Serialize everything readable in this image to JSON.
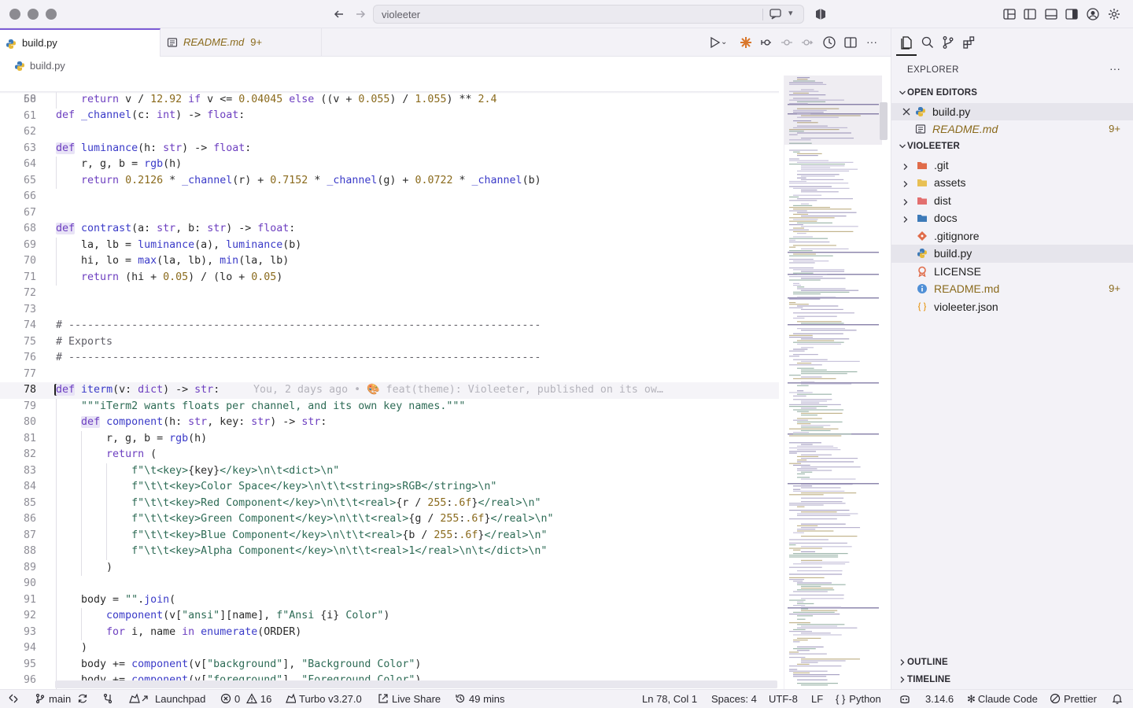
{
  "titlebar": {
    "search_text": "violeeter"
  },
  "tabs": [
    {
      "label": "build.py",
      "active": true
    },
    {
      "label": "README.md",
      "badge": "9+",
      "active": false
    }
  ],
  "breadcrumb": {
    "file": "build.py"
  },
  "editor": {
    "sticky_line": {
      "num": "58",
      "code": "def _channel(c: int) -> float:"
    },
    "current_line": "78",
    "blame": "You, 2 days ago • 🎨 feat(theme): Violeeter, published on its ow…",
    "lines": [
      "60",
      "61",
      "62",
      "63",
      "64",
      "65",
      "66",
      "67",
      "68",
      "69",
      "70",
      "71",
      "72",
      "73",
      "74",
      "75",
      "76",
      "77",
      "78",
      "79",
      "80",
      "81",
      "82",
      "83",
      "84",
      "85",
      "86",
      "87",
      "88",
      "89",
      "90",
      "91",
      "92",
      "93",
      "94",
      "95",
      "96"
    ]
  },
  "sidebar": {
    "title": "EXPLORER",
    "more": "···",
    "open_editors_label": "OPEN EDITORS",
    "open_editors": [
      {
        "label": "build.py"
      },
      {
        "label": "README.md",
        "badge": "9+"
      }
    ],
    "folder_label": "VIOLEETER",
    "tree": [
      {
        "label": ".git",
        "type": "folder"
      },
      {
        "label": "assets",
        "type": "folder"
      },
      {
        "label": "dist",
        "type": "folder"
      },
      {
        "label": "docs",
        "type": "folder"
      },
      {
        "label": ".gitignore",
        "type": "file"
      },
      {
        "label": "build.py",
        "type": "file"
      },
      {
        "label": "LICENSE",
        "type": "file"
      },
      {
        "label": "README.md",
        "type": "file",
        "badge": "9+"
      },
      {
        "label": "violeeter.json",
        "type": "file"
      }
    ],
    "outline_label": "OUTLINE",
    "timeline_label": "TIMELINE"
  },
  "statusbar": {
    "branch": "main",
    "launchpad": "Launchpad",
    "errors": "0",
    "warnings": "16",
    "turbo": "Turbo v3.27.0",
    "liveshare": "Live Share",
    "time": "49 mins",
    "position": "Ln 78, Col 1",
    "spaces": "Spaces: 4",
    "encoding": "UTF-8",
    "eol": "LF",
    "language": "Python",
    "python_version": "3.14.6",
    "claude": "Claude Code",
    "prettier": "Prettier"
  },
  "colors": {
    "accent": "#7c5cd6",
    "keyword": "#6d3fc0",
    "function": "#3a3ac8",
    "number": "#8a6a1c",
    "string": "#2d6b55"
  }
}
